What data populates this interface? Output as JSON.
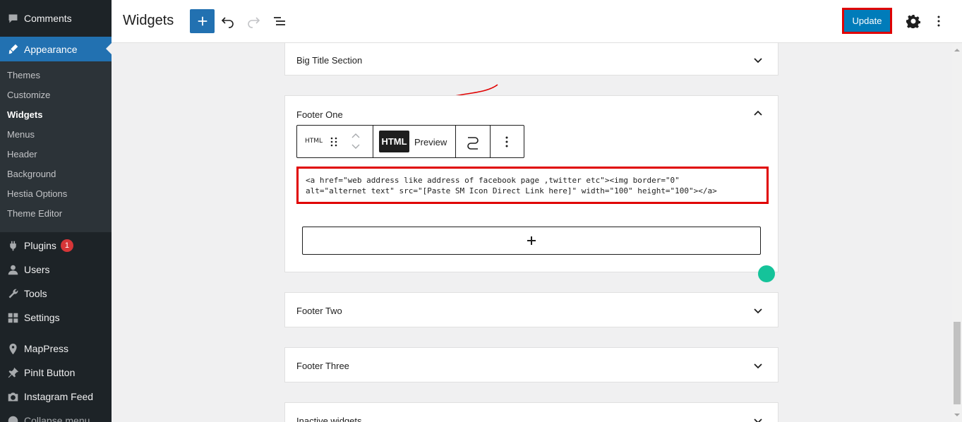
{
  "sidebar": {
    "items_top": [
      {
        "label": "Comments",
        "icon": "comment-icon"
      }
    ],
    "current": {
      "label": "Appearance",
      "icon": "paintbrush-icon"
    },
    "submenu": [
      "Themes",
      "Customize",
      "Widgets",
      "Menus",
      "Header",
      "Background",
      "Hestia Options",
      "Theme Editor"
    ],
    "active_sub": "Widgets",
    "items_bottom": [
      {
        "label": "Plugins",
        "icon": "plugin-icon",
        "badge": "1"
      },
      {
        "label": "Users",
        "icon": "users-icon"
      },
      {
        "label": "Tools",
        "icon": "wrench-icon"
      },
      {
        "label": "Settings",
        "icon": "settings-icon"
      },
      {
        "label": "MapPress",
        "icon": "map-pin-icon"
      },
      {
        "label": "PinIt Button",
        "icon": "pin-icon"
      },
      {
        "label": "Instagram Feed",
        "icon": "camera-icon"
      },
      {
        "label": "Collapse menu",
        "icon": "collapse-icon"
      }
    ]
  },
  "header": {
    "title": "Widgets",
    "update_label": "Update"
  },
  "panels": {
    "big_title": "Big Title Section",
    "footer_one": "Footer One",
    "footer_two": "Footer Two",
    "footer_three": "Footer Three",
    "inactive": "Inactive widgets"
  },
  "block_toolbar": {
    "block_label": "HTML",
    "html_tab": "HTML",
    "preview_tab": "Preview"
  },
  "code": {
    "line1": "<a href=\"web address like address of facebook page ,twitter etc\"><img border=\"0\"",
    "line2": "alt=\"alternet text\" src=\"[Paste SM Icon Direct Link here]\" width=\"100\" height=\"100\"></a>"
  },
  "colors": {
    "accent": "#2271b1",
    "highlight": "#e00000",
    "sidebar_bg": "#1d2327"
  }
}
